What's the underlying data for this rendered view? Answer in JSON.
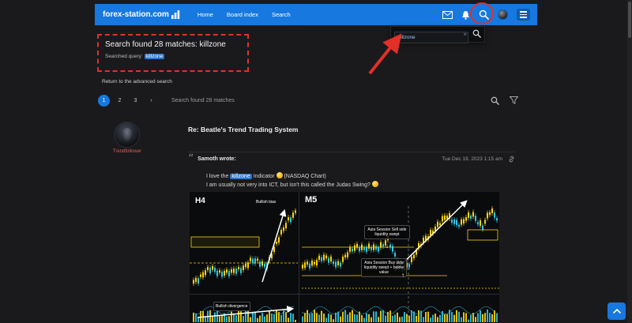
{
  "header": {
    "brand": "forex-station.com",
    "nav_home": "Home",
    "nav_board": "Board index",
    "nav_search": "Search"
  },
  "search_popover": {
    "value": "killzone",
    "clear": "×"
  },
  "results": {
    "heading": "Search found 28 matches: killzone",
    "query_label": "Searched query:",
    "query_term": "killzone",
    "advanced_link": "Return to the advanced search",
    "page1": "1",
    "page2": "2",
    "page3": "3",
    "next": "›",
    "summary": "Search found 28 matches"
  },
  "post": {
    "username": "Trendfollower",
    "title": "Re: Beatle's Trend Trading System",
    "quote_author": "Samoth wrote:",
    "timestamp": "Tue Dec 19, 2023 1:15 am",
    "line1_pre": "I love the",
    "line1_term": "killzone",
    "line1_mid": "Indicator",
    "emoji1": "😍",
    "line1_tail": "(NASDAQ Chart)",
    "line2": "I am usually not very into ICT, but isn't this called the Judas Swing?",
    "emoji2": "😄"
  },
  "chart": {
    "label_left": "H4",
    "label_right": "M5",
    "ann_bias": "Bullish bias",
    "ann_divergence": "Bullish divergence",
    "ann_sell": "Asia Session Sell side liquidity swept",
    "ann_buy": "Asia Session Buy side liquidity swept + below value",
    "marker_down": "↓",
    "marker_up": "↑"
  },
  "icons": {
    "quote_open": "“"
  },
  "colors": {
    "accent_blue": "#1778df",
    "highlight_blue": "#2b76c9",
    "annotation_red": "#e23028",
    "candle_yellow": "#ffd40a",
    "candle_cyan": "#2ec8ea"
  }
}
